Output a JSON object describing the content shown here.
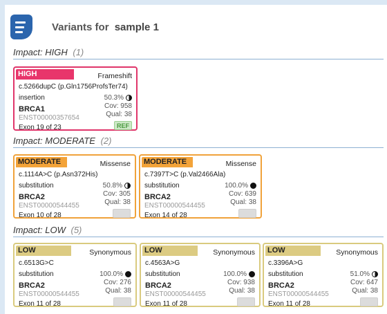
{
  "header": {
    "title": "Variants for",
    "sample": "sample 1",
    "menu_icon": "menu-icon"
  },
  "sections": {
    "high": {
      "label": "Impact: HIGH",
      "count": "(1)"
    },
    "moderate": {
      "label": "Impact: MODERATE",
      "count": "(2)"
    },
    "low": {
      "label": "Impact: LOW",
      "count": "(5)"
    }
  },
  "variants": [
    {
      "impact": "HIGH",
      "consequence": "Frameshift",
      "hgvs": "c.5266dupC (p.Gln1756ProfsTer74)",
      "type": "insertion",
      "af": "50.3%",
      "zygosity": "heterozygous",
      "cov": "Cov: 958",
      "qual": "Qual: 38",
      "gene": "BRCA1",
      "transcript": "ENST00000357654",
      "exon": "Exon 19 of 23",
      "ref": "REF"
    },
    {
      "impact": "MODERATE",
      "consequence": "Missense",
      "hgvs": "c.1114A>C (p.Asn372His)",
      "type": "substitution",
      "af": "50.8%",
      "zygosity": "heterozygous",
      "cov": "Cov: 305",
      "qual": "Qual: 38",
      "gene": "BRCA2",
      "transcript": "ENST00000544455",
      "exon": "Exon 10 of 28",
      "ref": ""
    },
    {
      "impact": "MODERATE",
      "consequence": "Missense",
      "hgvs": "c.7397T>C (p.Val2466Ala)",
      "type": "substitution",
      "af": "100.0%",
      "zygosity": "homozygous",
      "cov": "Cov: 639",
      "qual": "Qual: 38",
      "gene": "BRCA2",
      "transcript": "ENST00000544455",
      "exon": "Exon 14 of 28",
      "ref": ""
    },
    {
      "impact": "LOW",
      "consequence": "Synonymous",
      "hgvs": "c.6513G>C",
      "type": "substitution",
      "af": "100.0%",
      "zygosity": "homozygous",
      "cov": "Cov: 276",
      "qual": "Qual: 38",
      "gene": "BRCA2",
      "transcript": "ENST00000544455",
      "exon": "Exon 11 of 28",
      "ref": ""
    },
    {
      "impact": "LOW",
      "consequence": "Synonymous",
      "hgvs": "c.4563A>G",
      "type": "substitution",
      "af": "100.0%",
      "zygosity": "homozygous",
      "cov": "Cov: 938",
      "qual": "Qual: 38",
      "gene": "BRCA2",
      "transcript": "ENST00000544455",
      "exon": "Exon 11 of 28",
      "ref": ""
    },
    {
      "impact": "LOW",
      "consequence": "Synonymous",
      "hgvs": "c.3396A>G",
      "type": "substitution",
      "af": "51.0%",
      "zygosity": "heterozygous",
      "cov": "Cov: 647",
      "qual": "Qual: 38",
      "gene": "BRCA2",
      "transcript": "ENST00000544455",
      "exon": "Exon 11 of 28",
      "ref": ""
    }
  ],
  "colors": {
    "high": "#e8356b",
    "moderate": "#f3a339",
    "low": "#dccb82",
    "accent": "#2b65ad"
  }
}
